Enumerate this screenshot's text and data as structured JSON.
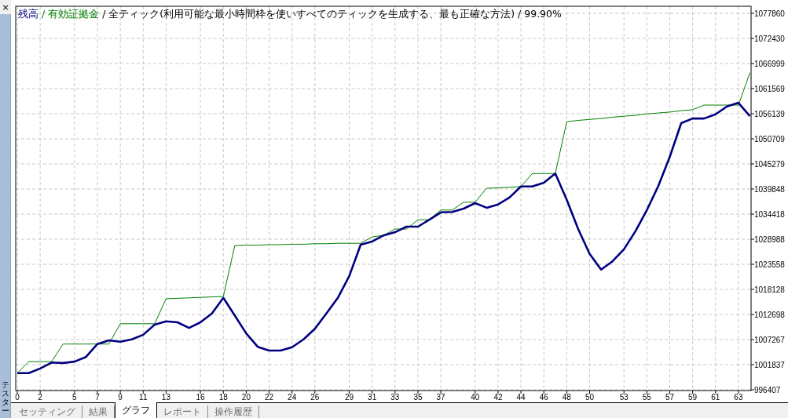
{
  "panel": {
    "close": "×",
    "title": "テスター"
  },
  "chart": {
    "legend_separator": "/",
    "model": "全ティック(利用可能な最小時間枠を使いすべてのティックを生成する、最も正確な方法)",
    "quality": "99.90%",
    "chart_data": {
      "type": "line",
      "grid": true,
      "xlim": [
        0,
        64
      ],
      "ylim": [
        996407,
        1077860
      ],
      "x": [
        0,
        1,
        2,
        3,
        4,
        5,
        6,
        7,
        8,
        9,
        10,
        11,
        12,
        13,
        14,
        15,
        16,
        17,
        18,
        19,
        20,
        21,
        22,
        23,
        24,
        25,
        26,
        27,
        28,
        29,
        30,
        31,
        32,
        33,
        34,
        35,
        36,
        37,
        38,
        39,
        40,
        41,
        42,
        43,
        44,
        45,
        46,
        47,
        48,
        49,
        50,
        51,
        52,
        53,
        54,
        55,
        56,
        57,
        58,
        59,
        60,
        61,
        62,
        63,
        64
      ],
      "series": [
        {
          "name": "残高",
          "color": "#000080",
          "values": [
            1000000,
            1000000,
            1001000,
            1002300,
            1002200,
            1002500,
            1003500,
            1006300,
            1007100,
            1006800,
            1007300,
            1008300,
            1010500,
            1011200,
            1011000,
            1009800,
            1011000,
            1012900,
            1016300,
            1012500,
            1008600,
            1005700,
            1004900,
            1004900,
            1005600,
            1007300,
            1009600,
            1012900,
            1016300,
            1021000,
            1027800,
            1028500,
            1029800,
            1030500,
            1031700,
            1031700,
            1033200,
            1034800,
            1034900,
            1035600,
            1036800,
            1035800,
            1036500,
            1038000,
            1040400,
            1040400,
            1041200,
            1043200,
            1037500,
            1031200,
            1025800,
            1022400,
            1024200,
            1026800,
            1030700,
            1035300,
            1040500,
            1046800,
            1054100,
            1055100,
            1055100,
            1056000,
            1057700,
            1058500,
            1055600
          ]
        },
        {
          "name": "有効証拠金",
          "color": "#008000",
          "values": [
            1000000,
            1002500,
            1002500,
            1002500,
            1006300,
            1006300,
            1006300,
            1006300,
            1006300,
            1010700,
            1010700,
            1010700,
            1010700,
            1016100,
            1016200,
            1016300,
            1016400,
            1016500,
            1016600,
            1027600,
            1027700,
            1027700,
            1027800,
            1027800,
            1027900,
            1027900,
            1028000,
            1028000,
            1028100,
            1028100,
            1028100,
            1029500,
            1029800,
            1031200,
            1031200,
            1033200,
            1033200,
            1035300,
            1035300,
            1037000,
            1037000,
            1040000,
            1040100,
            1040200,
            1040400,
            1043200,
            1043200,
            1043200,
            1054400,
            1054700,
            1054900,
            1055100,
            1055400,
            1055600,
            1055800,
            1056100,
            1056300,
            1056500,
            1056800,
            1057000,
            1058000,
            1058000,
            1058000,
            1058000,
            1065000
          ]
        }
      ],
      "xticks": [
        0,
        2,
        5,
        7,
        9,
        11,
        13,
        16,
        18,
        20,
        22,
        24,
        26,
        29,
        31,
        33,
        35,
        37,
        40,
        42,
        44,
        46,
        48,
        50,
        53,
        55,
        57,
        59,
        61,
        63
      ],
      "yticks": [
        996407,
        1001837,
        1007267,
        1012698,
        1018128,
        1023558,
        1028988,
        1034418,
        1039848,
        1045279,
        1050709,
        1056139,
        1061569,
        1066999,
        1072430,
        1077860
      ]
    }
  },
  "tabs": [
    {
      "label": "セッティング",
      "selected": false
    },
    {
      "label": "結果",
      "selected": false
    },
    {
      "label": "グラフ",
      "selected": true
    },
    {
      "label": "レポート",
      "selected": false
    },
    {
      "label": "操作履歴",
      "selected": false
    }
  ]
}
